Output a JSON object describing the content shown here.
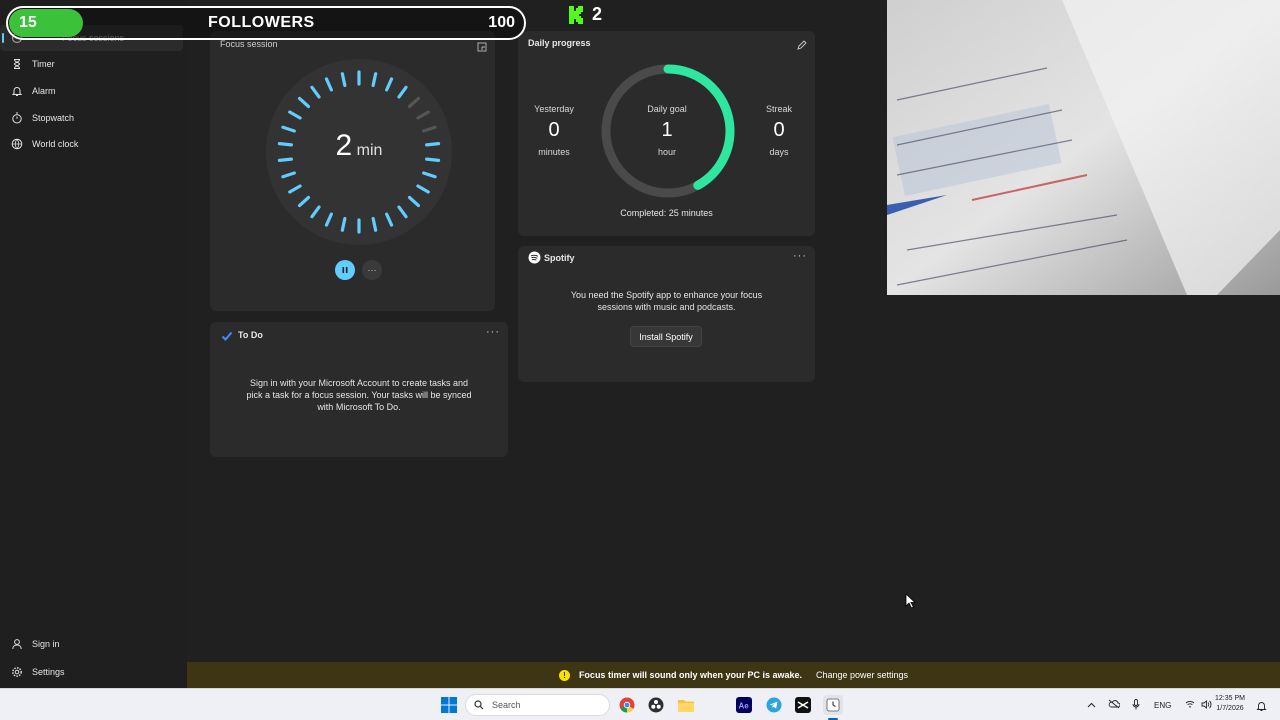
{
  "overlay": {
    "left_count": "15",
    "center_label": "FOLLOWERS",
    "right_count": "100",
    "kick_count": "2",
    "progress_fraction": 0.15
  },
  "sidebar": {
    "items": [
      {
        "label": "Focus sessions",
        "icon": "focus-icon"
      },
      {
        "label": "Timer",
        "icon": "hourglass-icon"
      },
      {
        "label": "Alarm",
        "icon": "bell-icon"
      },
      {
        "label": "Stopwatch",
        "icon": "stopwatch-icon"
      },
      {
        "label": "World clock",
        "icon": "globe-icon"
      }
    ],
    "bottom": [
      {
        "label": "Sign in",
        "icon": "person-icon"
      },
      {
        "label": "Settings",
        "icon": "gear-icon"
      }
    ]
  },
  "focus": {
    "title": "Focus session",
    "value": "2",
    "unit": "min",
    "more": "···"
  },
  "progress": {
    "title": "Daily progress",
    "yesterday": {
      "label": "Yesterday",
      "value": "0",
      "unit": "minutes"
    },
    "goal": {
      "label": "Daily goal",
      "value": "1",
      "unit": "hour"
    },
    "streak": {
      "label": "Streak",
      "value": "0",
      "unit": "days"
    },
    "completed": "Completed: 25 minutes",
    "fraction": 0.42
  },
  "spotify": {
    "title": "Spotify",
    "message_line1": "You need the Spotify app to enhance your focus",
    "message_line2": "sessions with music and podcasts.",
    "button": "Install Spotify"
  },
  "todo": {
    "title": "To Do",
    "line1": "Sign in with your Microsoft Account to create tasks and",
    "line2": "pick a task for a focus session. Your tasks will be synced",
    "line3": "with Microsoft To Do."
  },
  "infobar": {
    "icon": "!",
    "message": "Focus timer will sound only when your PC is awake.",
    "link": "Change power settings"
  },
  "taskbar": {
    "search_placeholder": "Search",
    "lang": "ENG",
    "time": "12:35 PM",
    "date": "1/7/2026"
  },
  "colors": {
    "accent": "#60cdff",
    "progress": "#2ee6a0",
    "overlay_green": "#3cc13a",
    "info_bg": "#3d3514"
  }
}
